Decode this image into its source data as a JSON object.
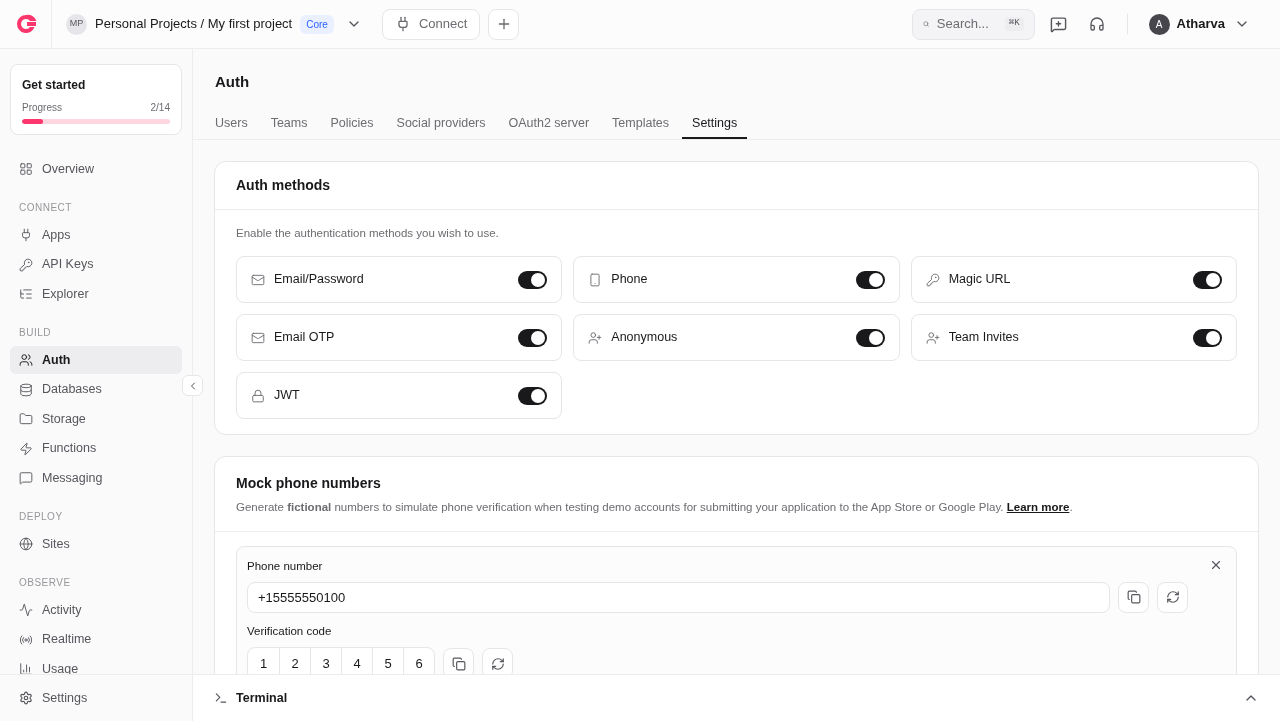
{
  "topbar": {
    "avatar": "MP",
    "project": "Personal Projects / My first project",
    "badge": "Core",
    "connect": "Connect",
    "search": {
      "placeholder": "Search...",
      "shortcut": "⌘K"
    },
    "user": {
      "initial": "A",
      "name": "Atharva"
    }
  },
  "sidebar": {
    "get_started": {
      "title": "Get started",
      "label": "Progress",
      "count": "2/14",
      "level": 0.143
    },
    "groups": [
      {
        "items": [
          {
            "kind": "overview",
            "label": "Overview",
            "selected": false
          }
        ]
      },
      {
        "heading": "CONNECT",
        "items": [
          {
            "kind": "plug",
            "label": "Apps",
            "selected": false
          },
          {
            "kind": "key",
            "label": "API Keys",
            "selected": false
          },
          {
            "kind": "explorer",
            "label": "Explorer",
            "selected": false
          }
        ]
      },
      {
        "heading": "BUILD",
        "items": [
          {
            "kind": "users",
            "label": "Auth",
            "selected": true
          },
          {
            "kind": "database",
            "label": "Databases",
            "selected": false
          },
          {
            "kind": "folder",
            "label": "Storage",
            "selected": false
          },
          {
            "kind": "zap",
            "label": "Functions",
            "selected": false
          },
          {
            "kind": "message",
            "label": "Messaging",
            "selected": false
          }
        ]
      },
      {
        "heading": "DEPLOY",
        "items": [
          {
            "kind": "globe",
            "label": "Sites",
            "selected": false
          }
        ]
      },
      {
        "heading": "OBSERVE",
        "items": [
          {
            "kind": "activity",
            "label": "Activity",
            "selected": false
          },
          {
            "kind": "radio",
            "label": "Realtime",
            "selected": false
          },
          {
            "kind": "chart",
            "label": "Usage",
            "selected": false
          }
        ]
      }
    ],
    "footer": "Settings"
  },
  "page": {
    "title": "Auth",
    "tabs": [
      {
        "label": "Users",
        "selected": false
      },
      {
        "label": "Teams",
        "selected": false
      },
      {
        "label": "Policies",
        "selected": false
      },
      {
        "label": "Social providers",
        "selected": false
      },
      {
        "label": "OAuth2 server",
        "selected": false
      },
      {
        "label": "Templates",
        "selected": false
      },
      {
        "label": "Settings",
        "selected": true
      }
    ]
  },
  "auth_methods": {
    "title": "Auth methods",
    "description": "Enable the authentication methods you wish to use.",
    "methods": [
      {
        "kind": "mail",
        "label": "Email/Password",
        "on": true
      },
      {
        "kind": "phone",
        "label": "Phone",
        "on": true
      },
      {
        "kind": "key",
        "label": "Magic URL",
        "on": true
      },
      {
        "kind": "mail",
        "label": "Email OTP",
        "on": true
      },
      {
        "kind": "user-plus",
        "label": "Anonymous",
        "on": true
      },
      {
        "kind": "user-plus",
        "label": "Team Invites",
        "on": true
      },
      {
        "kind": "lock",
        "label": "JWT",
        "on": true
      }
    ]
  },
  "mock_phone": {
    "title": "Mock phone numbers",
    "description": "Generate **fictional** numbers to simulate phone verification when testing demo accounts for submitting your application to the App Store or Google Play.",
    "link": "Learn more",
    "trailing": ".",
    "phone_label": "Phone number",
    "phone_value": "+15555550100",
    "code_label": "Verification code",
    "code": [
      "1",
      "2",
      "3",
      "4",
      "5",
      "6"
    ]
  },
  "terminal": {
    "title": "Terminal"
  }
}
